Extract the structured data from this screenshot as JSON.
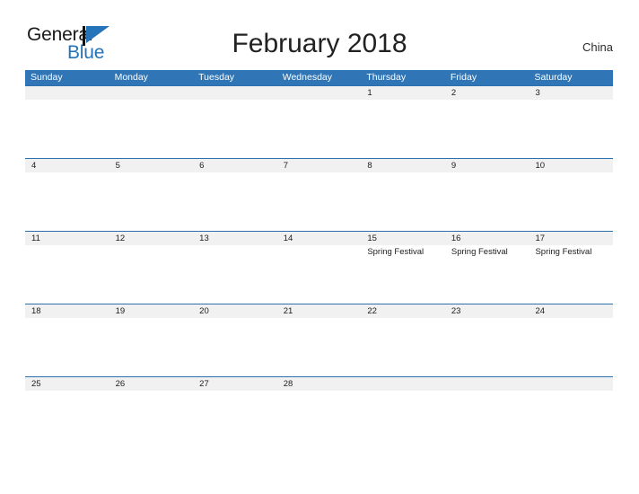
{
  "brand": {
    "name_part1": "General",
    "name_part2": "Blue",
    "accent_color": "#2573b8",
    "mark": "triangle-flag"
  },
  "header": {
    "title": "February 2018",
    "country": "China"
  },
  "calendar": {
    "header_bg": "#3075b5",
    "date_band_bg": "#f1f1f1",
    "rule_color": "#2e70ad",
    "weekdays": [
      "Sunday",
      "Monday",
      "Tuesday",
      "Wednesday",
      "Thursday",
      "Friday",
      "Saturday"
    ],
    "weeks": [
      [
        {
          "day": "",
          "event": ""
        },
        {
          "day": "",
          "event": ""
        },
        {
          "day": "",
          "event": ""
        },
        {
          "day": "",
          "event": ""
        },
        {
          "day": "1",
          "event": ""
        },
        {
          "day": "2",
          "event": ""
        },
        {
          "day": "3",
          "event": ""
        }
      ],
      [
        {
          "day": "4",
          "event": ""
        },
        {
          "day": "5",
          "event": ""
        },
        {
          "day": "6",
          "event": ""
        },
        {
          "day": "7",
          "event": ""
        },
        {
          "day": "8",
          "event": ""
        },
        {
          "day": "9",
          "event": ""
        },
        {
          "day": "10",
          "event": ""
        }
      ],
      [
        {
          "day": "11",
          "event": ""
        },
        {
          "day": "12",
          "event": ""
        },
        {
          "day": "13",
          "event": ""
        },
        {
          "day": "14",
          "event": ""
        },
        {
          "day": "15",
          "event": "Spring Festival"
        },
        {
          "day": "16",
          "event": "Spring Festival"
        },
        {
          "day": "17",
          "event": "Spring Festival"
        }
      ],
      [
        {
          "day": "18",
          "event": ""
        },
        {
          "day": "19",
          "event": ""
        },
        {
          "day": "20",
          "event": ""
        },
        {
          "day": "21",
          "event": ""
        },
        {
          "day": "22",
          "event": ""
        },
        {
          "day": "23",
          "event": ""
        },
        {
          "day": "24",
          "event": ""
        }
      ],
      [
        {
          "day": "25",
          "event": ""
        },
        {
          "day": "26",
          "event": ""
        },
        {
          "day": "27",
          "event": ""
        },
        {
          "day": "28",
          "event": ""
        },
        {
          "day": "",
          "event": ""
        },
        {
          "day": "",
          "event": ""
        },
        {
          "day": "",
          "event": ""
        }
      ]
    ]
  }
}
